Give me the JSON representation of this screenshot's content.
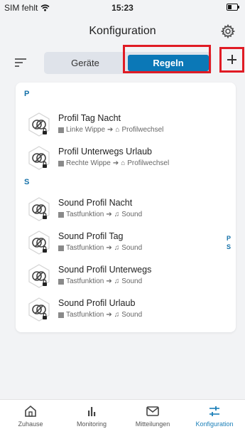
{
  "status": {
    "carrier": "SIM fehlt",
    "time": "15:23"
  },
  "header": {
    "title": "Konfiguration"
  },
  "segments": {
    "geraete": "Geräte",
    "regeln": "Regeln"
  },
  "sections": [
    {
      "letter": "P",
      "rules": [
        {
          "name": "Profil Tag Nacht",
          "trigger": "Linke Wippe",
          "action": "Profilwechsel"
        },
        {
          "name": "Profil Unterwegs Urlaub",
          "trigger": "Rechte Wippe",
          "action": "Profilwechsel"
        }
      ]
    },
    {
      "letter": "S",
      "rules": [
        {
          "name": "Sound Profil Nacht",
          "trigger": "Tastfunktion",
          "action": "Sound"
        },
        {
          "name": "Sound Profil Tag",
          "trigger": "Tastfunktion",
          "action": "Sound"
        },
        {
          "name": "Sound Profil Unterwegs",
          "trigger": "Tastfunktion",
          "action": "Sound"
        },
        {
          "name": "Sound Profil Urlaub",
          "trigger": "Tastfunktion",
          "action": "Sound"
        }
      ]
    }
  ],
  "index": [
    "P",
    "S"
  ],
  "tabs": [
    {
      "label": "Zuhause",
      "icon": "home-icon"
    },
    {
      "label": "Monitoring",
      "icon": "bar-chart-icon"
    },
    {
      "label": "Mitteilungen",
      "icon": "mail-icon"
    },
    {
      "label": "Konfiguration",
      "icon": "sliders-icon",
      "active": true
    }
  ],
  "colors": {
    "accent": "#0b78b7",
    "highlight": "#e01b24",
    "background": "#f2f3f5"
  }
}
